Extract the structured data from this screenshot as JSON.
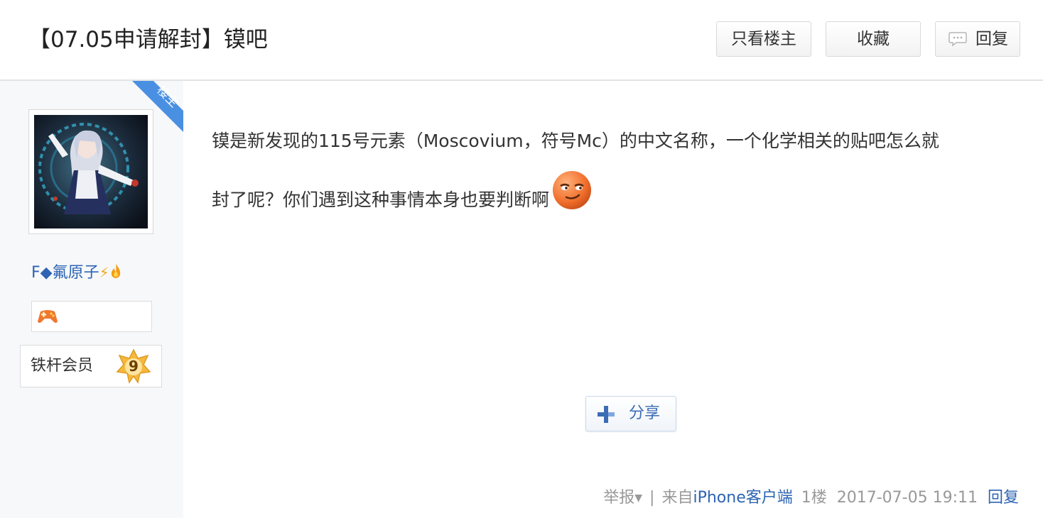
{
  "header": {
    "title": "【07.05申请解封】镆吧",
    "buttons": {
      "only_owner": "只看楼主",
      "favorite": "收藏",
      "reply": "回复"
    }
  },
  "sidebar": {
    "owner_tag": "楼主",
    "username_prefix": "F◆",
    "username": "氟原子",
    "username_suffix_icons": [
      "lightning-icon",
      "fire-icon"
    ],
    "member_label": "铁杆会员",
    "level": "9"
  },
  "post": {
    "line1": "镆是新发现的115号元素（Moscovium，符号Mc）的中文名称，一个化学相关的贴吧怎么就",
    "line2": "封了呢？你们遇到这种事情本身也要判断啊",
    "emoji": "smirk-face-emoji"
  },
  "share": {
    "label": "分享"
  },
  "footer": {
    "report": "举报",
    "separator": "|",
    "client_prefix": "来自",
    "client": "iPhone客户端",
    "floor": "1楼",
    "timestamp": "2017-07-05 19:11",
    "reply": "回复"
  },
  "colors": {
    "link_blue": "#2d64b3",
    "owner_tag_blue": "#4a90e2",
    "meta_gray": "#999999",
    "sidebar_bg": "#f7f8fa"
  }
}
